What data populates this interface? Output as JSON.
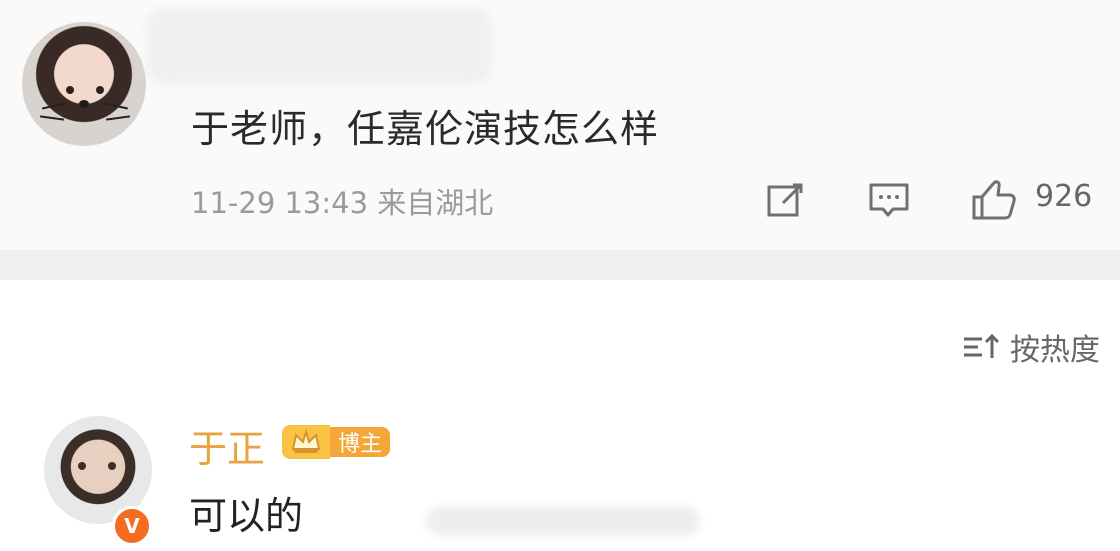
{
  "post": {
    "text": "于老师，任嘉伦演技怎么样",
    "time_location": "11-29 13:43 来自湖北",
    "like_count": "926",
    "icons": [
      "share-icon",
      "comment-icon",
      "like-icon"
    ]
  },
  "sort": {
    "label": "按热度",
    "icon": "sort-icon"
  },
  "reply": {
    "author": "于正",
    "badge_label": "博主",
    "text": "可以的",
    "verified_icon_text": "V"
  }
}
